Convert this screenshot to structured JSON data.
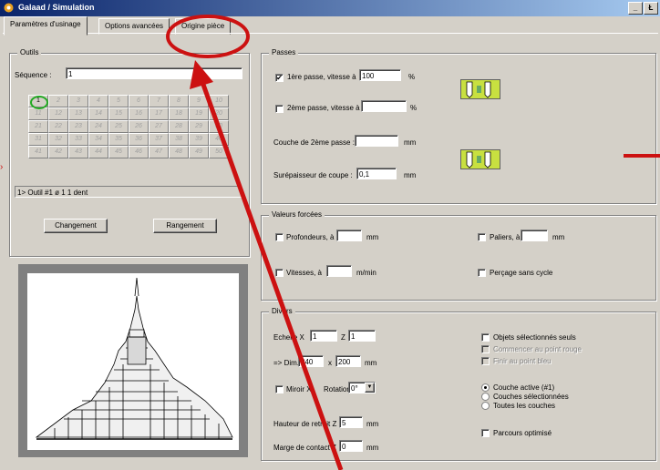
{
  "window": {
    "title": "Galaad / Simulation",
    "minimize": "_",
    "restore": "Ł"
  },
  "tabs": [
    {
      "label": "Paramètres d'usinage"
    },
    {
      "label": "Options avancées"
    },
    {
      "label": "Origine pièce"
    }
  ],
  "outils": {
    "title": "Outils",
    "sequence_label": "Séquence :",
    "sequence_value": "1",
    "grid": [
      "1",
      "2",
      "3",
      "4",
      "5",
      "6",
      "7",
      "8",
      "9",
      "10",
      "11",
      "12",
      "13",
      "14",
      "15",
      "16",
      "17",
      "18",
      "19",
      "20",
      "21",
      "22",
      "23",
      "24",
      "25",
      "26",
      "27",
      "28",
      "29",
      "30",
      "31",
      "32",
      "33",
      "34",
      "35",
      "36",
      "37",
      "38",
      "39",
      "40",
      "41",
      "42",
      "43",
      "44",
      "45",
      "46",
      "47",
      "48",
      "49",
      "50"
    ],
    "selected": "1",
    "tool_info": "1> Outil #1   ø 1   1 dent",
    "changement": "Changement",
    "rangement": "Rangement"
  },
  "passes": {
    "title": "Passes",
    "pass1_label": "1ère passe, vitesse à",
    "pass1_value": "100",
    "pass1_unit": "%",
    "pass1_checked": "✔",
    "pass2_label": "2ème passe, vitesse à",
    "pass2_value": "",
    "pass2_unit": "%",
    "couche_label": "Couche de 2ème passe :",
    "couche_value": "",
    "couche_unit": "mm",
    "surepaisseur_label": "Surépaisseur de coupe :",
    "surepaisseur_value": "0,1",
    "surepaisseur_unit": "mm"
  },
  "valeurs": {
    "title": "Valeurs forcées",
    "profondeurs_label": "Profondeurs, à",
    "profondeurs_unit": "mm",
    "paliers_label": "Paliers, à",
    "paliers_unit": "mm",
    "vitesses_label": "Vitesses, à",
    "vitesses_unit": "m/min",
    "percage_label": "Perçage sans cycle"
  },
  "divers": {
    "title": "Divers",
    "echelle_label": "Echelle X",
    "echelle_x": "1",
    "z_label": "Z",
    "echelle_z": "1",
    "dim_label": "=> Dim.",
    "dim_x": "240",
    "dim_sep": "x",
    "dim_y": "200",
    "dim_unit": "mm",
    "miroir_label": "Miroir X",
    "rotation_label": "Rotation",
    "rotation_value": "0°",
    "hauteur_label": "Hauteur de retrait Z",
    "hauteur_value": "5",
    "hauteur_unit": "mm",
    "marge_label": "Marge de contact Z",
    "marge_value": "0",
    "marge_unit": "mm",
    "objets_label": "Objets sélectionnés seuls",
    "commencer_label": "Commencer au point rouge",
    "finir_label": "Finir au point bleu",
    "couche_active_label": "Couche active (#1)",
    "couches_sel_label": "Couches sélectionnées",
    "toutes_label": "Toutes les couches",
    "parcours_label": "Parcours optimisé"
  },
  "colors": {
    "annotation": "#cc1111",
    "titlebar": "#0a246a",
    "tool_green": "#c8e040"
  }
}
